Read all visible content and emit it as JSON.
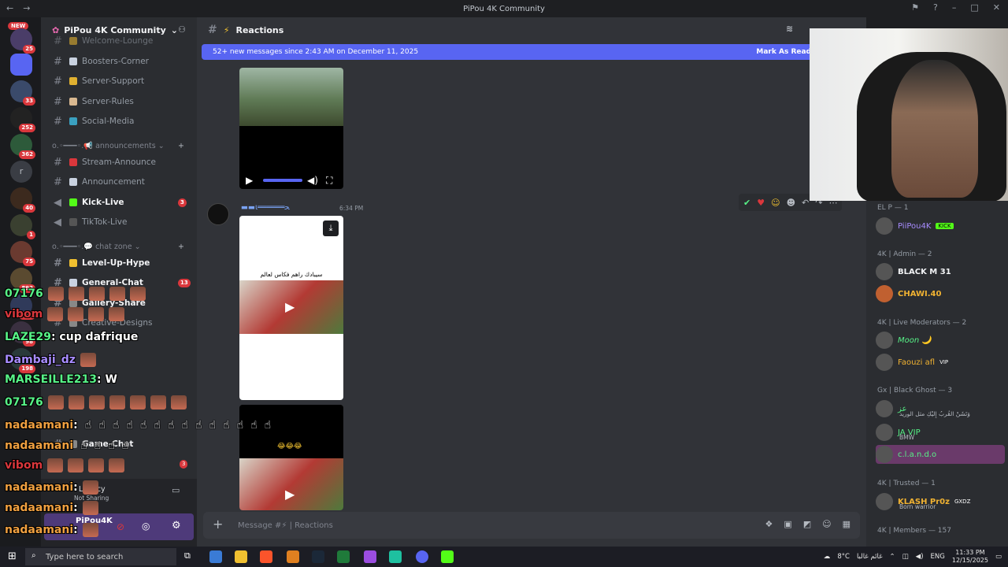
{
  "titlebar": {
    "title": "PiPou 4K Community"
  },
  "servers": {
    "new_label": "NEW",
    "badges": [
      "25",
      "33",
      "252",
      "362",
      "40",
      "1",
      "75",
      "892",
      "898",
      "98",
      "198"
    ]
  },
  "sidebar": {
    "server_name": "PiPou 4K Community",
    "channels": [
      {
        "name": "Welcome-Lounge"
      },
      {
        "name": "Boosters-Corner"
      },
      {
        "name": "Server-Support"
      },
      {
        "name": "Server-Rules"
      },
      {
        "name": "Social-Media"
      }
    ],
    "cat_announcements": "announcements",
    "channels2": [
      {
        "name": "Stream-Announce"
      },
      {
        "name": "Announcement"
      },
      {
        "name": "Kick-Live",
        "badge": "3"
      },
      {
        "name": "TikTok-Live"
      }
    ],
    "cat_chat": "chat zone",
    "channels3": [
      {
        "name": "Level-Up-Hype"
      },
      {
        "name": "General-Chat",
        "badge": "13"
      },
      {
        "name": "Gallery-Share"
      },
      {
        "name": "Creative-Designs"
      },
      {
        "name": "Game-Chat"
      }
    ],
    "misc_badge": "3",
    "user": {
      "name": "PiPou4K",
      "status": "Not Sharing",
      "stage_label": "Legacy"
    }
  },
  "channel": {
    "name": "Reactions",
    "new_messages": "52+ new messages since 2:43 AM on December 11, 2025",
    "mark_label": "Mark As Read"
  },
  "message": {
    "author": "▬▬ι══════ﺤ",
    "time": "6:34 PM",
    "video_text": "سيبادك راهم فكاس لعالم",
    "video_sub": "😂😂😂"
  },
  "composer": {
    "placeholder": "Message #⚡ | Reactions"
  },
  "members": {
    "groups": [
      {
        "role": "EL P — 1",
        "members": [
          {
            "name": "PiiPou4K",
            "tag": "KICK",
            "color": "#a88cff"
          }
        ]
      },
      {
        "role": "4K | Admin — 2",
        "members": [
          {
            "name": "BLACK M 31",
            "color": "#f2f3f5"
          },
          {
            "name": "CHAWI.40",
            "color": "#f0b232"
          }
        ]
      },
      {
        "role": "4K | Live Moderators — 2",
        "members": [
          {
            "name": "Moon 🌙",
            "color": "#57f287"
          },
          {
            "name": "Faouzi afl",
            "tag": "VIP",
            "color": "#f0b232"
          }
        ]
      },
      {
        "role": "Gx | Black Ghost — 3",
        "members": [
          {
            "name": "عز",
            "sub": "ﻭَﺗَﺸَﻦْ ﺍﻟﻘُﺮﺏُ ﺇِﻟﻴْﻚِ ﻣﺜﻞ ﺍﻟﻮﺭﻳﺪ",
            "color": "#57f287"
          },
          {
            "name": "JA VIP",
            "sub": "BMW",
            "color": "#57f287"
          },
          {
            "name": "c.l.a.n.d.o",
            "color": "#57f287"
          }
        ]
      },
      {
        "role": "4K | Trusted — 1",
        "members": [
          {
            "name": "KLASH Pr0z",
            "tag": "GXDZ",
            "sub": "Born warrior",
            "color": "#f0b232"
          }
        ]
      },
      {
        "role": "4K | Members — 157",
        "members": []
      }
    ]
  },
  "overlay": [
    {
      "user": "07176",
      "color": "#57f287",
      "text": "",
      "faces": 5
    },
    {
      "user": "vibom",
      "color": "#da373c",
      "text": "",
      "faces": 4
    },
    {
      "user": "LAZE29",
      "color": "#57f287",
      "text": ": cup dafrique",
      "faces": 0
    },
    {
      "user": "Dambaji_dz",
      "color": "#a88cff",
      "text": "",
      "faces": 1
    },
    {
      "user": "MARSEILLE213",
      "color": "#57f287",
      "text": ": W",
      "faces": 0
    },
    {
      "user": "07176",
      "color": "#57f287",
      "text": "",
      "faces": 7
    },
    {
      "user": "nadaamani",
      "color": "#f0a040",
      "text": ":",
      "hands": 14
    },
    {
      "user": "nadaamani",
      "color": "#f0a040",
      "text": "",
      "hands": 4
    },
    {
      "user": "vibom",
      "color": "#da373c",
      "text": "",
      "faces": 4
    },
    {
      "user": "nadaamani",
      "color": "#f0a040",
      "text": ":",
      "faces": 1
    },
    {
      "user": "nadaamani",
      "color": "#f0a040",
      "text": ":",
      "faces": 1
    },
    {
      "user": "nadaamani",
      "color": "#f0a040",
      "text": ":",
      "faces": 1
    }
  ],
  "taskbar": {
    "search_placeholder": "Type here to search",
    "weather": "8°C",
    "weather_text": "غائم غالبا",
    "lang": "ENG",
    "time": "11:33 PM",
    "date": "12/15/2025"
  }
}
